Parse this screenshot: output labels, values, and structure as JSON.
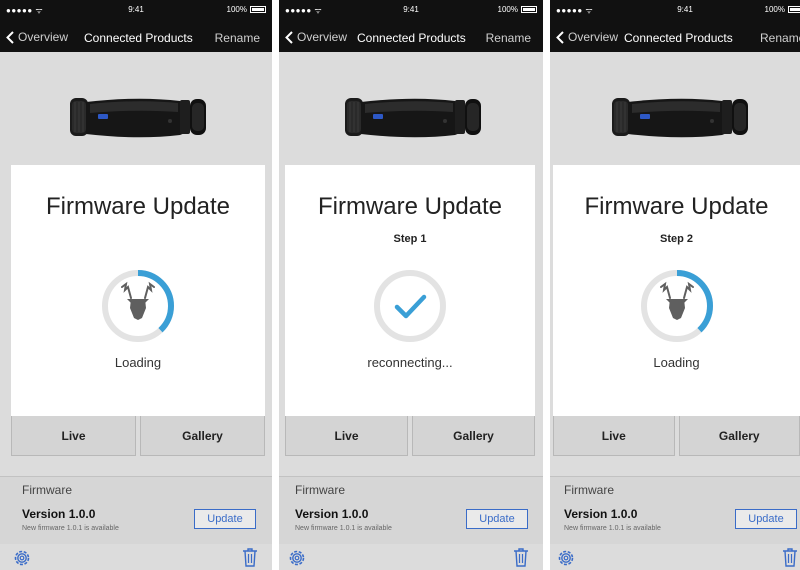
{
  "colors": {
    "accent": "#3a6cc8",
    "progress": "#3a9fd6",
    "ring_track": "#e3e3e3",
    "navbar": "#111111"
  },
  "panels": [
    {
      "status": {
        "signal": "●●●●● ᯤ",
        "time": "9:41",
        "battery": "100%"
      },
      "nav": {
        "back": "Overview",
        "title": "Connected Products",
        "action": "Rename"
      },
      "modal": {
        "title": "Firmware Update",
        "step": "",
        "status": "Loading",
        "icon": "deer-icon",
        "progress": 0.38
      },
      "tiles": {
        "live": "Live",
        "gallery": "Gallery"
      },
      "firmware": {
        "heading": "Firmware",
        "version": "Version 1.0.0",
        "note": "New firmware 1.0.1 is available",
        "button": "Update"
      }
    },
    {
      "status": {
        "signal": "●●●●● ᯤ",
        "time": "9:41",
        "battery": "100%"
      },
      "nav": {
        "back": "Overview",
        "title": "Connected Products",
        "action": "Rename"
      },
      "modal": {
        "title": "Firmware Update",
        "step": "Step 1",
        "status": "reconnecting...",
        "icon": "checkmark-icon",
        "progress": 0
      },
      "tiles": {
        "live": "Live",
        "gallery": "Gallery"
      },
      "firmware": {
        "heading": "Firmware",
        "version": "Version 1.0.0",
        "note": "New firmware 1.0.1 is available",
        "button": "Update"
      }
    },
    {
      "status": {
        "signal": "●●●●● ᯤ",
        "time": "9:41",
        "battery": "100%"
      },
      "nav": {
        "back": "Overview",
        "title": "Connected Products",
        "action": "Rename"
      },
      "modal": {
        "title": "Firmware Update",
        "step": "Step 2",
        "status": "Loading",
        "icon": "deer-icon",
        "progress": 0.38
      },
      "tiles": {
        "live": "Live",
        "gallery": "Gallery"
      },
      "firmware": {
        "heading": "Firmware",
        "version": "Version 1.0.0",
        "note": "New firmware 1.0.1 is available",
        "button": "Update"
      }
    }
  ]
}
